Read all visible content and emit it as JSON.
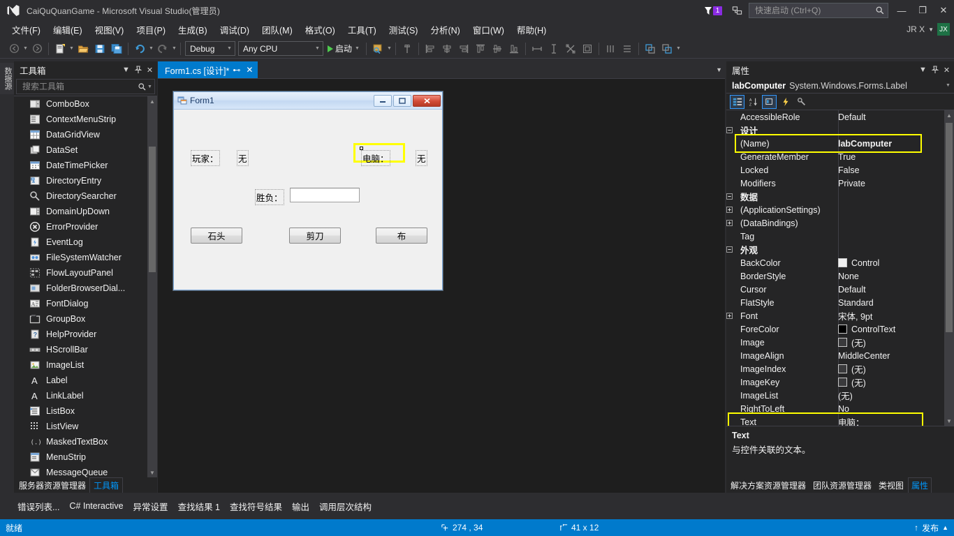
{
  "window": {
    "title": "CaiQuQuanGame - Microsoft Visual Studio(管理员)",
    "minimize_label": "—",
    "restore_label": "❐",
    "close_label": "✕"
  },
  "titlebar": {
    "notification_count": "1",
    "quicklaunch_placeholder": "快速启动 (Ctrl+Q)",
    "quicklaunch_value": ""
  },
  "menubar": {
    "items": [
      {
        "label": "文件(F)"
      },
      {
        "label": "编辑(E)"
      },
      {
        "label": "视图(V)"
      },
      {
        "label": "项目(P)"
      },
      {
        "label": "生成(B)"
      },
      {
        "label": "调试(D)"
      },
      {
        "label": "团队(M)"
      },
      {
        "label": "格式(O)"
      },
      {
        "label": "工具(T)"
      },
      {
        "label": "测试(S)"
      },
      {
        "label": "分析(N)"
      },
      {
        "label": "窗口(W)"
      },
      {
        "label": "帮助(H)"
      }
    ],
    "user_name": "JR X",
    "avatar_initials": "JX"
  },
  "toolbar": {
    "config_value": "Debug",
    "platform_value": "Any CPU",
    "run_label": "启动"
  },
  "toolbox": {
    "vertical_tab": "数据源",
    "title": "工具箱",
    "search_placeholder": "搜索工具箱",
    "search_value": "",
    "items": [
      {
        "label": "ComboBox",
        "icon": "combobox-icon"
      },
      {
        "label": "ContextMenuStrip",
        "icon": "contextmenustrip-icon"
      },
      {
        "label": "DataGridView",
        "icon": "datagridview-icon"
      },
      {
        "label": "DataSet",
        "icon": "dataset-icon"
      },
      {
        "label": "DateTimePicker",
        "icon": "datetimepicker-icon"
      },
      {
        "label": "DirectoryEntry",
        "icon": "directoryentry-icon"
      },
      {
        "label": "DirectorySearcher",
        "icon": "directorysearcher-icon"
      },
      {
        "label": "DomainUpDown",
        "icon": "domainupdown-icon"
      },
      {
        "label": "ErrorProvider",
        "icon": "errorprovider-icon"
      },
      {
        "label": "EventLog",
        "icon": "eventlog-icon"
      },
      {
        "label": "FileSystemWatcher",
        "icon": "filesystemwatcher-icon"
      },
      {
        "label": "FlowLayoutPanel",
        "icon": "flowlayoutpanel-icon"
      },
      {
        "label": "FolderBrowserDial...",
        "icon": "folderbrowserdialog-icon"
      },
      {
        "label": "FontDialog",
        "icon": "fontdialog-icon"
      },
      {
        "label": "GroupBox",
        "icon": "groupbox-icon"
      },
      {
        "label": "HelpProvider",
        "icon": "helpprovider-icon"
      },
      {
        "label": "HScrollBar",
        "icon": "hscrollbar-icon"
      },
      {
        "label": "ImageList",
        "icon": "imagelist-icon"
      },
      {
        "label": "Label",
        "icon": "label-icon"
      },
      {
        "label": "LinkLabel",
        "icon": "linklabel-icon"
      },
      {
        "label": "ListBox",
        "icon": "listbox-icon"
      },
      {
        "label": "ListView",
        "icon": "listview-icon"
      },
      {
        "label": "MaskedTextBox",
        "icon": "maskedtextbox-icon"
      },
      {
        "label": "MenuStrip",
        "icon": "menustrip-icon"
      },
      {
        "label": "MessageQueue",
        "icon": "messagequeue-icon"
      }
    ],
    "tabs": [
      {
        "label": "服务器资源管理器",
        "active": false
      },
      {
        "label": "工具箱",
        "active": true
      }
    ]
  },
  "document": {
    "tab_label": "Form1.cs [设计]*"
  },
  "form_designer": {
    "form_title": "Form1",
    "labels": [
      {
        "name": "labPlayerTitle",
        "text": "玩家："
      },
      {
        "name": "labPlayer",
        "text": "无"
      },
      {
        "name": "labComputer",
        "text": "电脑：",
        "selected": true
      },
      {
        "name": "labComputerValue",
        "text": "无"
      },
      {
        "name": "labResultTitle",
        "text": "胜负："
      }
    ],
    "textbox_value": "",
    "buttons": [
      {
        "label": "石头"
      },
      {
        "label": "剪刀"
      },
      {
        "label": "布"
      }
    ]
  },
  "properties": {
    "title": "属性",
    "object_name": "labComputer",
    "object_type": "System.Windows.Forms.Label",
    "rows": [
      {
        "expander": "",
        "name": "AccessibleRole",
        "value": "Default",
        "category": false
      },
      {
        "expander": "−",
        "name": "设计",
        "value": "",
        "category": true
      },
      {
        "expander": "",
        "name": "(Name)",
        "value": "labComputer",
        "category": false,
        "highlight": true,
        "bold_value": true
      },
      {
        "expander": "",
        "name": "GenerateMember",
        "value": "True",
        "category": false
      },
      {
        "expander": "",
        "name": "Locked",
        "value": "False",
        "category": false
      },
      {
        "expander": "",
        "name": "Modifiers",
        "value": "Private",
        "category": false
      },
      {
        "expander": "−",
        "name": "数据",
        "value": "",
        "category": true
      },
      {
        "expander": "+",
        "name": "(ApplicationSettings)",
        "value": "",
        "category": false
      },
      {
        "expander": "+",
        "name": "(DataBindings)",
        "value": "",
        "category": false
      },
      {
        "expander": "",
        "name": "Tag",
        "value": "",
        "category": false
      },
      {
        "expander": "−",
        "name": "外观",
        "value": "",
        "category": true
      },
      {
        "expander": "",
        "name": "BackColor",
        "value": "Control",
        "category": false,
        "swatch": "#f0f0f0"
      },
      {
        "expander": "",
        "name": "BorderStyle",
        "value": "None",
        "category": false
      },
      {
        "expander": "",
        "name": "Cursor",
        "value": "Default",
        "category": false
      },
      {
        "expander": "",
        "name": "FlatStyle",
        "value": "Standard",
        "category": false
      },
      {
        "expander": "+",
        "name": "Font",
        "value": "宋体, 9pt",
        "category": false
      },
      {
        "expander": "",
        "name": "ForeColor",
        "value": "ControlText",
        "category": false,
        "swatch": "#000000"
      },
      {
        "expander": "",
        "name": "Image",
        "value": "(无)",
        "category": false,
        "swatch": "#3a3a3c"
      },
      {
        "expander": "",
        "name": "ImageAlign",
        "value": "MiddleCenter",
        "category": false
      },
      {
        "expander": "",
        "name": "ImageIndex",
        "value": "(无)",
        "category": false,
        "swatch": "#3a3a3c"
      },
      {
        "expander": "",
        "name": "ImageKey",
        "value": "(无)",
        "category": false,
        "swatch": "#3a3a3c"
      },
      {
        "expander": "",
        "name": "ImageList",
        "value": "(无)",
        "category": false
      },
      {
        "expander": "",
        "name": "RightToLeft",
        "value": "No",
        "category": false
      },
      {
        "expander": "",
        "name": "Text",
        "value": "电脑：",
        "category": false,
        "highlight": true
      }
    ],
    "description_title": "Text",
    "description_body": "与控件关联的文本。",
    "tabs": [
      {
        "label": "解决方案资源管理器",
        "active": false
      },
      {
        "label": "团队资源管理器",
        "active": false
      },
      {
        "label": "类视图",
        "active": false
      },
      {
        "label": "属性",
        "active": true
      }
    ]
  },
  "bottom_tabs": [
    {
      "label": "错误列表..."
    },
    {
      "label": "C# Interactive"
    },
    {
      "label": "异常设置"
    },
    {
      "label": "查找结果 1"
    },
    {
      "label": "查找符号结果"
    },
    {
      "label": "输出"
    },
    {
      "label": "调用层次结构"
    }
  ],
  "statusbar": {
    "status": "就绪",
    "cursor_position": "274 , 34",
    "selection_size": "41 x 12",
    "publish_label": "发布"
  },
  "colors": {
    "accent": "#007acc",
    "highlight_yellow": "#ffff00",
    "chrome_bg": "#2d2d30",
    "panel_bg": "#252526",
    "designer_bg": "#1e1e1e"
  }
}
